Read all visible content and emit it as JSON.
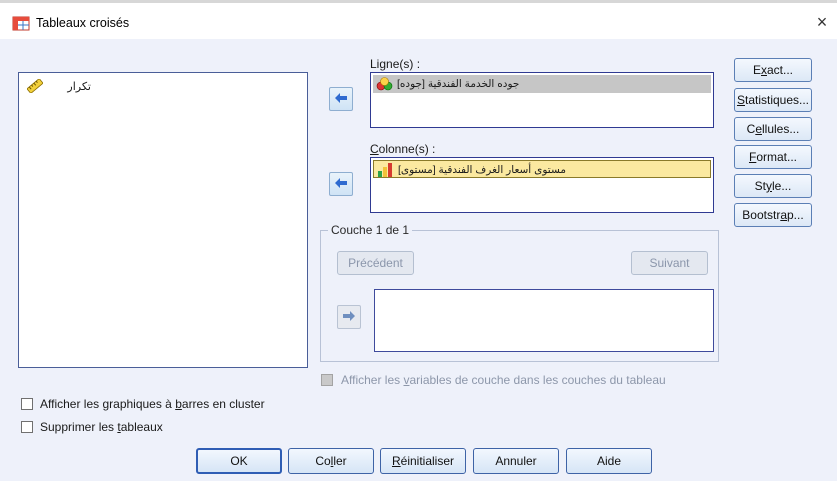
{
  "window": {
    "title": "Tableaux croisés",
    "close_label": "×"
  },
  "source_list": {
    "items": [
      {
        "label": "تكرار",
        "icon": "ruler-scale-icon"
      }
    ]
  },
  "rows": {
    "label_parts": [
      "Li",
      "g",
      "ne(s) :"
    ],
    "items": [
      {
        "label": "جوده الخدمة  الفندقية [جوده]",
        "icon": "nominal-circles-icon"
      }
    ]
  },
  "columns": {
    "label_parts": [
      "",
      "C",
      "olonne(s) :"
    ],
    "items": [
      {
        "label": "مستوى أسعار الغرف الفندقية [مستوى]",
        "icon": "ordinal-bars-icon"
      }
    ]
  },
  "layer": {
    "caption": "Couche 1 de 1",
    "previous_label": "Précédent",
    "next_label": "Suivant"
  },
  "right_buttons": [
    {
      "pre": "E",
      "u": "x",
      "post": "act..."
    },
    {
      "pre": "",
      "u": "S",
      "post": "tatistiques..."
    },
    {
      "pre": "C",
      "u": "e",
      "post": "llules..."
    },
    {
      "pre": "",
      "u": "F",
      "post": "ormat..."
    },
    {
      "pre": "St",
      "u": "y",
      "post": "le..."
    },
    {
      "pre": "Bootstr",
      "u": "a",
      "post": "p..."
    }
  ],
  "layer_vars_checkbox": {
    "pre": "Afficher les ",
    "u": "v",
    "post": "ariables de couche dans les couches du tableau",
    "checked": false,
    "disabled": true
  },
  "options": [
    {
      "pre": "Afficher les graphiques à ",
      "u": "b",
      "post": "arres en cluster",
      "checked": false
    },
    {
      "pre": "Supprimer les ",
      "u": "t",
      "post": "ableaux",
      "checked": false
    }
  ],
  "bottom_buttons": [
    {
      "pre": "",
      "u": "",
      "post": "OK"
    },
    {
      "pre": "Co",
      "u": "l",
      "post": "ler"
    },
    {
      "pre": "",
      "u": "R",
      "post": "éinitialiser"
    },
    {
      "pre": "",
      "u": "",
      "post": "Annuler"
    },
    {
      "pre": "",
      "u": "",
      "post": "Aide"
    }
  ],
  "colors": {
    "accent": "#2f5db4",
    "dialog_bg": "#eef1fa",
    "arrow_blue": "#3b6fd1"
  }
}
